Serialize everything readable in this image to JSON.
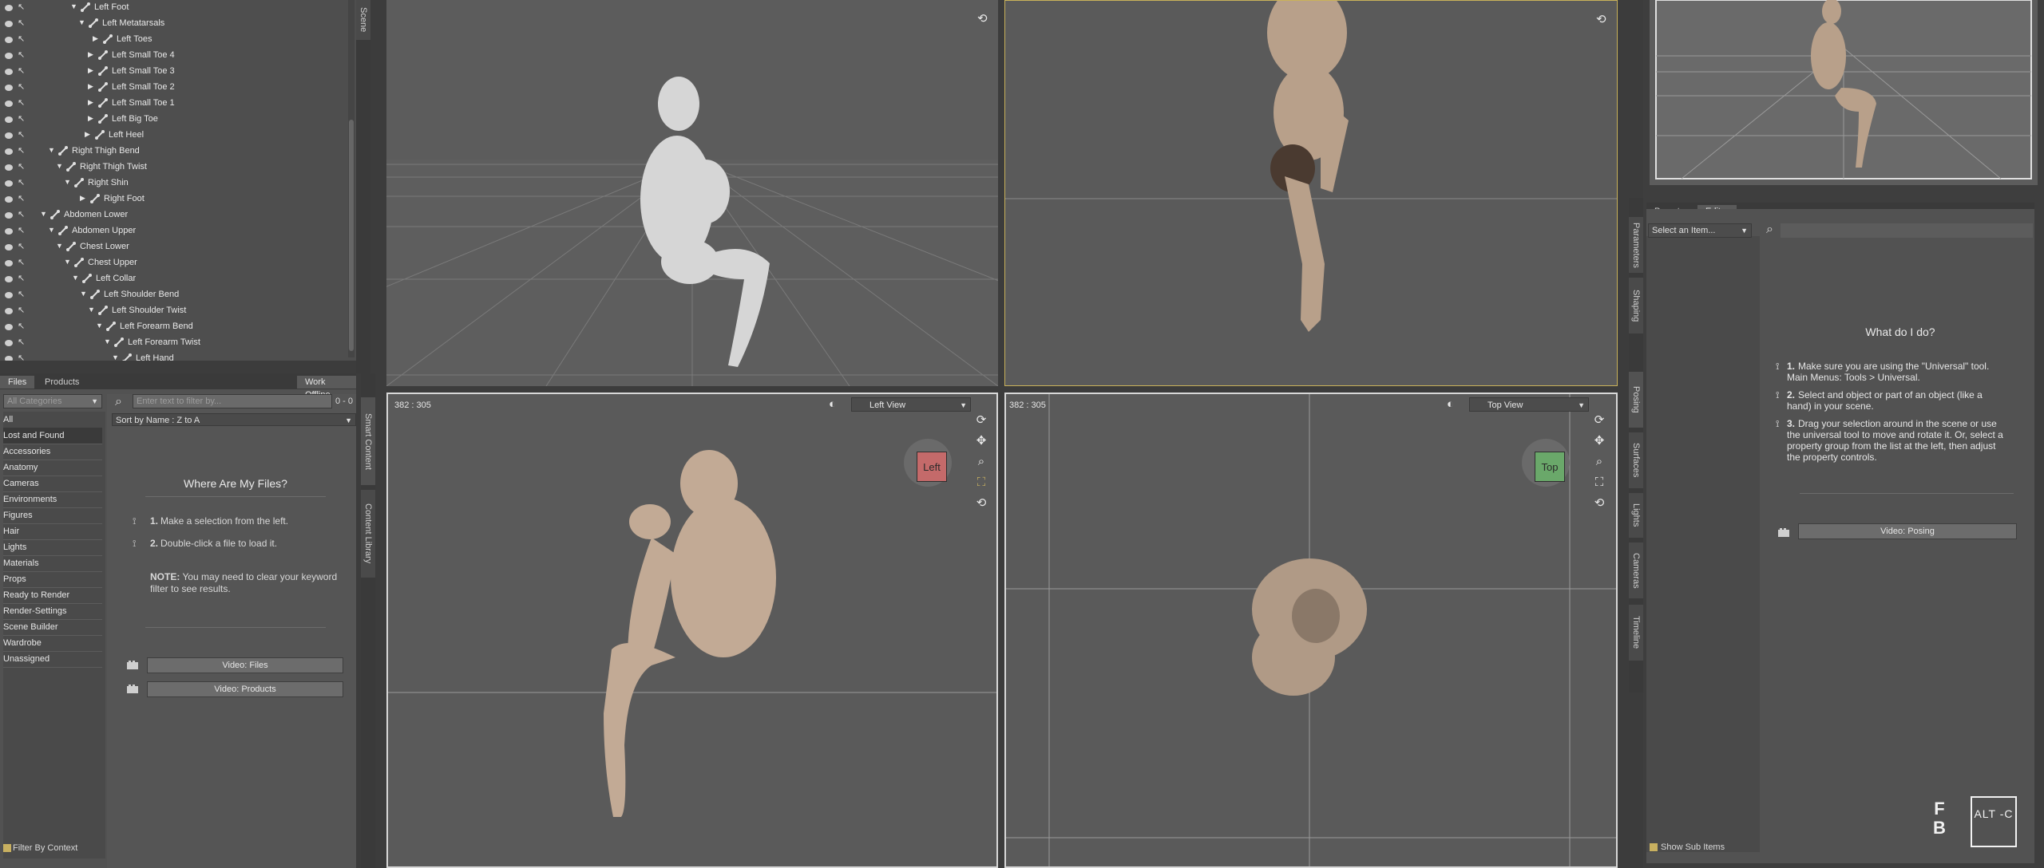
{
  "scene_tree": {
    "rows": [
      {
        "label": "Left Foot",
        "indent": 100,
        "expanded": true
      },
      {
        "label": "Left Metatarsals",
        "indent": 110,
        "expanded": true
      },
      {
        "label": "Left Toes",
        "indent": 128,
        "expanded": false
      },
      {
        "label": "Left Small Toe 4",
        "indent": 122,
        "expanded": false
      },
      {
        "label": "Left Small Toe 3",
        "indent": 122,
        "expanded": false
      },
      {
        "label": "Left Small Toe 2",
        "indent": 122,
        "expanded": false
      },
      {
        "label": "Left Small Toe 1",
        "indent": 122,
        "expanded": false
      },
      {
        "label": "Left Big Toe",
        "indent": 122,
        "expanded": false
      },
      {
        "label": "Left Heel",
        "indent": 118,
        "expanded": false
      },
      {
        "label": "Right Thigh Bend",
        "indent": 72,
        "expanded": true
      },
      {
        "label": "Right Thigh Twist",
        "indent": 82,
        "expanded": true
      },
      {
        "label": "Right Shin",
        "indent": 92,
        "expanded": true
      },
      {
        "label": "Right Foot",
        "indent": 112,
        "expanded": false
      },
      {
        "label": "Abdomen Lower",
        "indent": 62,
        "expanded": true
      },
      {
        "label": "Abdomen Upper",
        "indent": 72,
        "expanded": true
      },
      {
        "label": "Chest Lower",
        "indent": 82,
        "expanded": true
      },
      {
        "label": "Chest Upper",
        "indent": 92,
        "expanded": true
      },
      {
        "label": "Left Collar",
        "indent": 102,
        "expanded": true
      },
      {
        "label": "Left Shoulder Bend",
        "indent": 112,
        "expanded": true
      },
      {
        "label": "Left Shoulder Twist",
        "indent": 122,
        "expanded": true
      },
      {
        "label": "Left Forearm Bend",
        "indent": 132,
        "expanded": true
      },
      {
        "label": "Left Forearm Twist",
        "indent": 142,
        "expanded": true
      },
      {
        "label": "Left Hand",
        "indent": 152,
        "expanded": true
      }
    ]
  },
  "content_library": {
    "tabs": [
      "Files",
      "Products"
    ],
    "work_offline": "Work Offline",
    "category_filter_placeholder": "All Categories",
    "categories": [
      "All",
      "Lost and Found",
      "Accessories",
      "Anatomy",
      "Cameras",
      "Environments",
      "Figures",
      "Hair",
      "Lights",
      "Materials",
      "Props",
      "Ready to Render",
      "Render-Settings",
      "Scene Builder",
      "Wardrobe",
      "Unassigned"
    ],
    "filter_placeholder": "Enter text to filter by...",
    "count": "0 - 0",
    "sort": "Sort by Name : Z to A",
    "help_title": "Where Are My Files?",
    "step1_num": "1.",
    "step1": "Make a selection from the left.",
    "step2_num": "2.",
    "step2": "Double-click a file to load it.",
    "note_label": "NOTE:",
    "note": "You may need to clear your keyword filter to see results.",
    "video_files": "Video: Files",
    "video_products": "Video:  Products",
    "filter_by_context": "Filter By Context",
    "side_tabs": [
      "Smart Content",
      "Content Library"
    ],
    "top_side_tab": "Scene"
  },
  "viewports": {
    "left_view": {
      "coords": "382 : 305",
      "view": "Left View",
      "cube": "Left",
      "cube_color": "#c46a6a"
    },
    "top_view": {
      "coords": "382 : 305",
      "view": "Top View",
      "cube": "Top",
      "cube_color": "#6aa86a"
    },
    "nav_icons": [
      "orbit-icon",
      "pan-icon",
      "zoom-icon",
      "frame-icon",
      "reset-icon"
    ]
  },
  "right_panel": {
    "vertical_tabs": [
      "Parameters",
      "Shaping",
      "Posing",
      "Surfaces",
      "Lights",
      "Cameras",
      "Timeline"
    ],
    "active_tab": "Posing",
    "sub_tabs": [
      "Presets",
      "Editor"
    ],
    "active_sub_tab": "Editor",
    "select_item": "Select an Item...",
    "help_title": "What do I do?",
    "help_steps": [
      {
        "num": "1.",
        "lines": [
          "Make sure you are using the \"Universal\" tool.",
          "Main Menus: Tools > Universal."
        ]
      },
      {
        "num": "2.",
        "lines": [
          "Select and object or part of an object (like a",
          "hand) in your scene."
        ]
      },
      {
        "num": "3.",
        "lines": [
          "Drag your selection around in the scene or use",
          "the universal tool to move and rotate it. Or, select a",
          "property group from the list at the left, then adjust",
          "the property controls."
        ]
      }
    ],
    "video_posing": "Video: Posing",
    "show_sub_items": "Show Sub Items"
  },
  "branding": {
    "fb": "F B",
    "altc": "ALT -C"
  },
  "colors": {
    "accent_gold": "#c8b060",
    "active_viewport_border": "#c9b25a"
  }
}
